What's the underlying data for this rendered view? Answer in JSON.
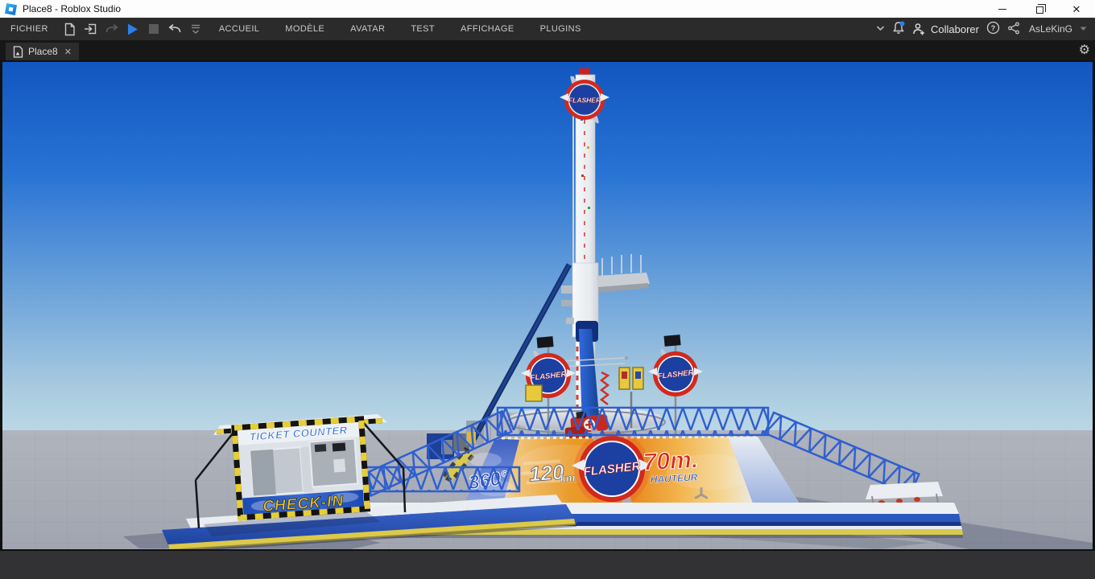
{
  "window": {
    "title": "Place8 - Roblox Studio",
    "icons": {
      "settings_gear": "⚙",
      "tab_close": "✕",
      "window_close": "✕"
    }
  },
  "menu_bar": {
    "file_menu": "FICHIER",
    "menus": [
      "ACCUEIL",
      "MODÈLE",
      "AVATAR",
      "TEST",
      "AFFICHAGE",
      "PLUGINS"
    ],
    "toolbar_icons": [
      "new-file-icon",
      "open-place-icon",
      "redo-icon",
      "play-icon",
      "stop-icon",
      "undo-icon",
      "toolbar-options-icon"
    ],
    "right": {
      "collaborate_label": "Collaborer",
      "username": "AsLeKinG"
    }
  },
  "tab_bar": {
    "active_tab": "Place8"
  },
  "scene": {
    "signage": {
      "ride_logo": "FLASHER",
      "spin_badge": "360°",
      "speed_value": "120",
      "speed_unit": "km",
      "height_value": "70m.",
      "height_label": "HAUTEUR",
      "ticket_counter": "TICKET COUNTER",
      "check_in": "CHECK-IN"
    },
    "colors": {
      "sky_top": "#1256c0",
      "sky_horizon": "#bcd8e6",
      "ground": "#a8acb5",
      "ride_blue": "#2f5ecf",
      "accent_yellow": "#dcc94a",
      "logo_red": "#d2291e",
      "logo_navy": "#1b40a2"
    }
  }
}
